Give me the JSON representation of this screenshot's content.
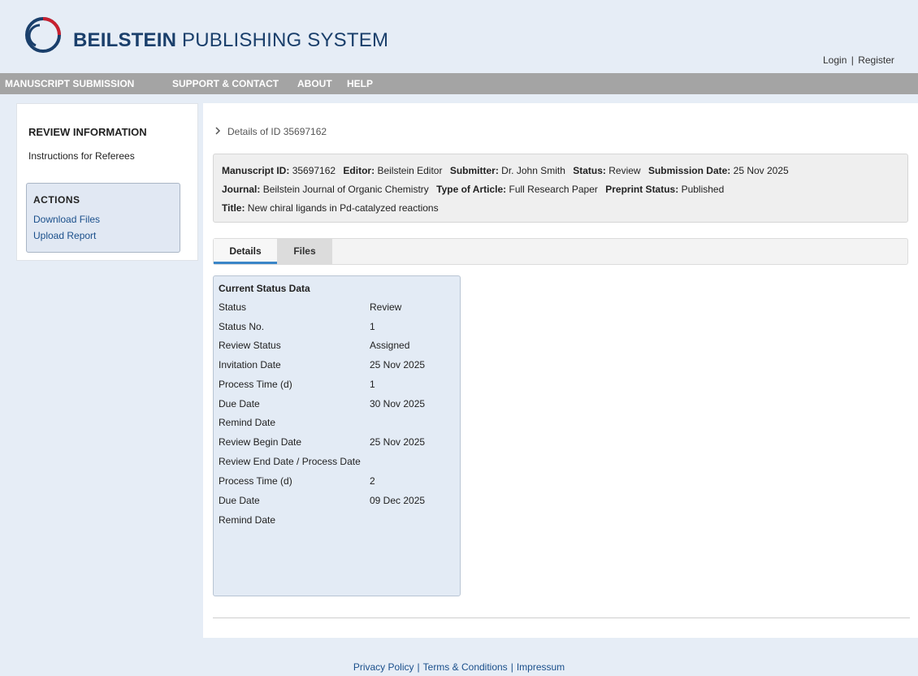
{
  "header": {
    "logo_icon": "circular-swirl-logo-icon",
    "brand_bold": "BEILSTEIN",
    "brand_rest": " PUBLISHING SYSTEM",
    "login": "Login",
    "separator": "|",
    "register": "Register"
  },
  "nav": {
    "items": [
      "MANUSCRIPT SUBMISSION",
      "SUPPORT & CONTACT",
      "ABOUT",
      "HELP"
    ]
  },
  "sidebar": {
    "review_title": "REVIEW INFORMATION",
    "instructions_link": "Instructions for Referees",
    "actions_title": "ACTIONS",
    "actions": [
      "Download Files",
      "Upload Report"
    ]
  },
  "breadcrumb": {
    "chevron_icon": "chevron-right-icon",
    "text": "Details of ID 35697162"
  },
  "manuscript": {
    "id_label": "Manuscript ID:",
    "id_value": "35697162",
    "editor_label": "Editor:",
    "editor_value": "Beilstein Editor",
    "submitter_label": "Submitter:",
    "submitter_value": "Dr. John Smith",
    "status_label": "Status:",
    "status_value": "Review",
    "date_label": "Submission Date:",
    "date_value": "25 Nov 2025",
    "journal_label": "Journal:",
    "journal_value": "Beilstein Journal of Organic Chemistry",
    "type_label": "Type of Article:",
    "type_value": "Full Research Paper",
    "preprint_label": "Preprint Status:",
    "preprint_value": "Published",
    "title_label": "Title:",
    "title_value": "New chiral ligands in Pd-catalyzed reactions"
  },
  "tabs": [
    {
      "label": "Details",
      "active": true
    },
    {
      "label": "Files",
      "active": false
    }
  ],
  "status_panel": {
    "title": "Current Status Data",
    "rows": [
      {
        "label": "Status",
        "value": "Review"
      },
      {
        "label": "Status No.",
        "value": "1"
      },
      {
        "label": "Review Status",
        "value": "Assigned"
      },
      {
        "label": "Invitation Date",
        "value": "25 Nov 2025"
      },
      {
        "label": "Process Time (d)",
        "value": "1"
      },
      {
        "label": "Due Date",
        "value": "30 Nov 2025"
      },
      {
        "label": "Remind Date",
        "value": ""
      },
      {
        "label": "Review Begin Date",
        "value": "25 Nov 2025"
      },
      {
        "label": "Review End Date / Process Date",
        "value": ""
      },
      {
        "label": "Process Time (d)",
        "value": "2"
      },
      {
        "label": "Due Date",
        "value": "09 Dec 2025"
      },
      {
        "label": "Remind Date",
        "value": ""
      }
    ]
  },
  "footer": {
    "privacy": "Privacy Policy",
    "terms": "Terms & Conditions",
    "impressum": "Impressum",
    "separator": "|"
  },
  "colors": {
    "page_bg": "#e6edf6",
    "nav_bg": "#a4a4a4",
    "brand": "#1a3f6b",
    "link": "#1a4f8b",
    "tab_accent": "#3a86c8",
    "logo_red": "#c8202f",
    "logo_blue": "#1a3f6b"
  }
}
